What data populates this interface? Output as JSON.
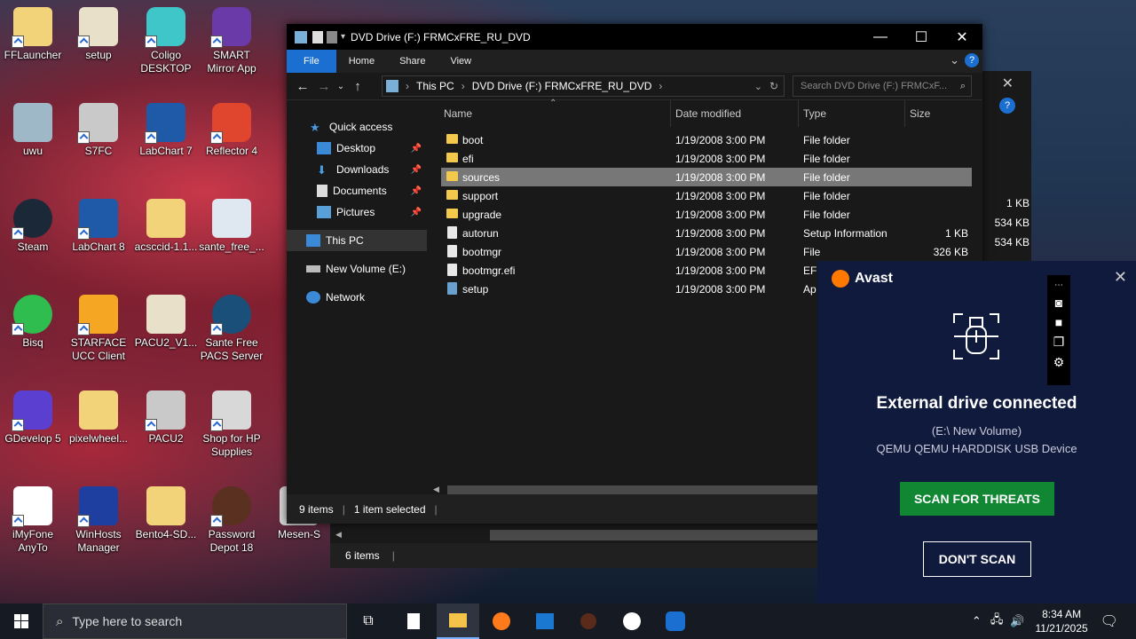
{
  "desktop_icons": [
    {
      "label": "FFLauncher"
    },
    {
      "label": "setup"
    },
    {
      "label": "Coligo DESKTOP"
    },
    {
      "label": "SMART Mirror App"
    },
    {
      "label": "uwu"
    },
    {
      "label": "S7FC"
    },
    {
      "label": "LabChart 7"
    },
    {
      "label": "Reflector 4"
    },
    {
      "label": "Steam"
    },
    {
      "label": "LabChart 8"
    },
    {
      "label": "acsccid-1.1..."
    },
    {
      "label": "sante_free_..."
    },
    {
      "label": "Bisq"
    },
    {
      "label": "STARFACE UCC Client"
    },
    {
      "label": "PACU2_V1..."
    },
    {
      "label": "Sante Free PACS Server"
    },
    {
      "label": "GDevelop 5"
    },
    {
      "label": "pixelwheel..."
    },
    {
      "label": "PACU2"
    },
    {
      "label": "Shop for HP Supplies"
    },
    {
      "label": "iMyFone AnyTo"
    },
    {
      "label": "WinHosts Manager"
    },
    {
      "label": "Bento4-SD..."
    },
    {
      "label": "Password Depot 18"
    },
    {
      "label": "Mesen-S"
    }
  ],
  "explorer": {
    "title": "DVD Drive (F:) FRMCxFRE_RU_DVD",
    "ribbon_tabs": [
      "File",
      "Home",
      "Share",
      "View"
    ],
    "breadcrumb": [
      "This PC",
      "DVD Drive (F:) FRMCxFRE_RU_DVD"
    ],
    "search_placeholder": "Search DVD Drive (F:) FRMCxF...",
    "nav": {
      "quick_access": "Quick access",
      "desktop": "Desktop",
      "downloads": "Downloads",
      "documents": "Documents",
      "pictures": "Pictures",
      "this_pc": "This PC",
      "new_volume": "New Volume (E:)",
      "network": "Network"
    },
    "columns": {
      "name": "Name",
      "date": "Date modified",
      "type": "Type",
      "size": "Size"
    },
    "files": [
      {
        "name": "boot",
        "date": "1/19/2008 3:00 PM",
        "type": "File folder",
        "size": ""
      },
      {
        "name": "efi",
        "date": "1/19/2008 3:00 PM",
        "type": "File folder",
        "size": ""
      },
      {
        "name": "sources",
        "date": "1/19/2008 3:00 PM",
        "type": "File folder",
        "size": ""
      },
      {
        "name": "support",
        "date": "1/19/2008 3:00 PM",
        "type": "File folder",
        "size": ""
      },
      {
        "name": "upgrade",
        "date": "1/19/2008 3:00 PM",
        "type": "File folder",
        "size": ""
      },
      {
        "name": "autorun",
        "date": "1/19/2008 3:00 PM",
        "type": "Setup Information",
        "size": "1 KB"
      },
      {
        "name": "bootmgr",
        "date": "1/19/2008 3:00 PM",
        "type": "File",
        "size": "326 KB"
      },
      {
        "name": "bootmgr.efi",
        "date": "1/19/2008 3:00 PM",
        "type": "EFI",
        "size": ""
      },
      {
        "name": "setup",
        "date": "1/19/2008 3:00 PM",
        "type": "Ap",
        "size": ""
      }
    ],
    "status_items": "9 items",
    "status_selected": "1 item selected"
  },
  "explorer_behind": {
    "status_items": "6 items",
    "sizes": [
      "1 KB",
      "534 KB",
      "534 KB"
    ]
  },
  "avast": {
    "brand": "Avast",
    "heading": "External drive connected",
    "volume": "(E:\\ New Volume)",
    "device": "QEMU QEMU HARDDISK USB Device",
    "scan_label": "SCAN FOR THREATS",
    "dont_scan_label": "DON'T SCAN"
  },
  "taskbar": {
    "search_placeholder": "Type here to search",
    "time": "8:34 AM",
    "date": "11/21/2025"
  },
  "colors": {
    "accent": "#1a6fd0",
    "avast_bg": "#0f1a3c",
    "avast_green": "#118633",
    "avast_orange": "#ff7800"
  }
}
